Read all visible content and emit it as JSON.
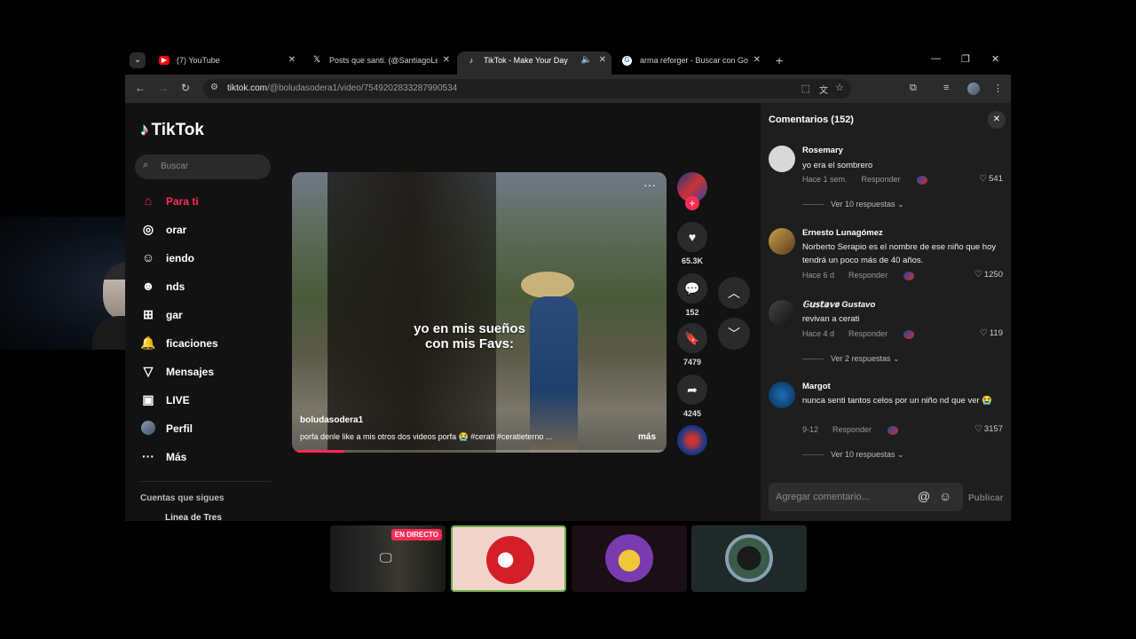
{
  "browser": {
    "tabs": [
      {
        "title": "(7) YouTube",
        "favicon": "youtube-icon",
        "active": false
      },
      {
        "title": "Posts que santi. (@SantiagoLei",
        "favicon": "x-icon",
        "active": false
      },
      {
        "title": "TikTok - Make Your Day",
        "favicon": "tiktok-icon",
        "active": true
      },
      {
        "title": "arma reforger - Buscar con Goo",
        "favicon": "google-icon",
        "active": false
      }
    ],
    "url_domain": "tiktok.com",
    "url_path": "/@boludasodera1/video/7549202833287990534"
  },
  "sidebar": {
    "logo_text": "TikTok",
    "search_placeholder": "Buscar",
    "items": [
      {
        "label": "Para ti",
        "icon": "home-icon"
      },
      {
        "label": "orar",
        "icon": "compass-icon"
      },
      {
        "label": "iendo",
        "icon": "following-icon"
      },
      {
        "label": "nds",
        "icon": "friends-icon"
      },
      {
        "label": "gar",
        "icon": "upload-icon"
      },
      {
        "label": "ficaciones",
        "icon": "bell-icon"
      },
      {
        "label": "Mensajes",
        "icon": "send-icon"
      },
      {
        "label": "LIVE",
        "icon": "live-icon"
      },
      {
        "label": "Perfil",
        "icon": "avatar-icon"
      },
      {
        "label": "Más",
        "icon": "more-icon"
      }
    ],
    "following_header": "Cuentas que sigues",
    "following_first": "Linea de Tres"
  },
  "video": {
    "caption_line1": "yo en mis sueños",
    "caption_line2": "con mis Favs:",
    "username": "boludasodera1",
    "description": "porfa denle like a mis otros dos videos porfa 😭 #cerati #ceratieterno ...",
    "more_label": "más",
    "progress": 0.14
  },
  "actions": {
    "likes": "65.3K",
    "comments": "152",
    "saves": "7479",
    "shares": "4245"
  },
  "comments_panel": {
    "title": "Comentarios (152)",
    "input_placeholder": "Agregar comentario...",
    "post_label": "Publicar",
    "items": [
      {
        "name": "Rosemary",
        "text": "yo era el sombrero",
        "time": "Hace 1 sem.",
        "reply": "Responder",
        "likes": "541",
        "view_replies": "Ver 10 respuestas"
      },
      {
        "name": "Ernesto Lunagómez",
        "text": "Norberto Serapio es el nombre de ese niño que hoy tendrá un poco más de 40 años.",
        "time": "Hace 6 d",
        "reply": "Responder",
        "likes": "1250",
        "view_replies": ""
      },
      {
        "name": "𝔾𝕦𝕤𝕥𝕒𝕧𝕠 Gustavo",
        "text": "revivan a cerati",
        "time": "Hace 4 d",
        "reply": "Responder",
        "likes": "119",
        "view_replies": "Ver 2 respuestas"
      },
      {
        "name": "Margot",
        "text": "nunca senti tantos celos por un niño nd que ver 😭",
        "time": "9-12",
        "reply": "Responder",
        "likes": "3157",
        "view_replies": "Ver 10 respuestas"
      }
    ]
  },
  "thumbnails": {
    "live_badge": "EN DIRECTO"
  },
  "colors": {
    "accent": "#fe2c55",
    "bg": "#121212",
    "panel": "#1e1e1e"
  }
}
